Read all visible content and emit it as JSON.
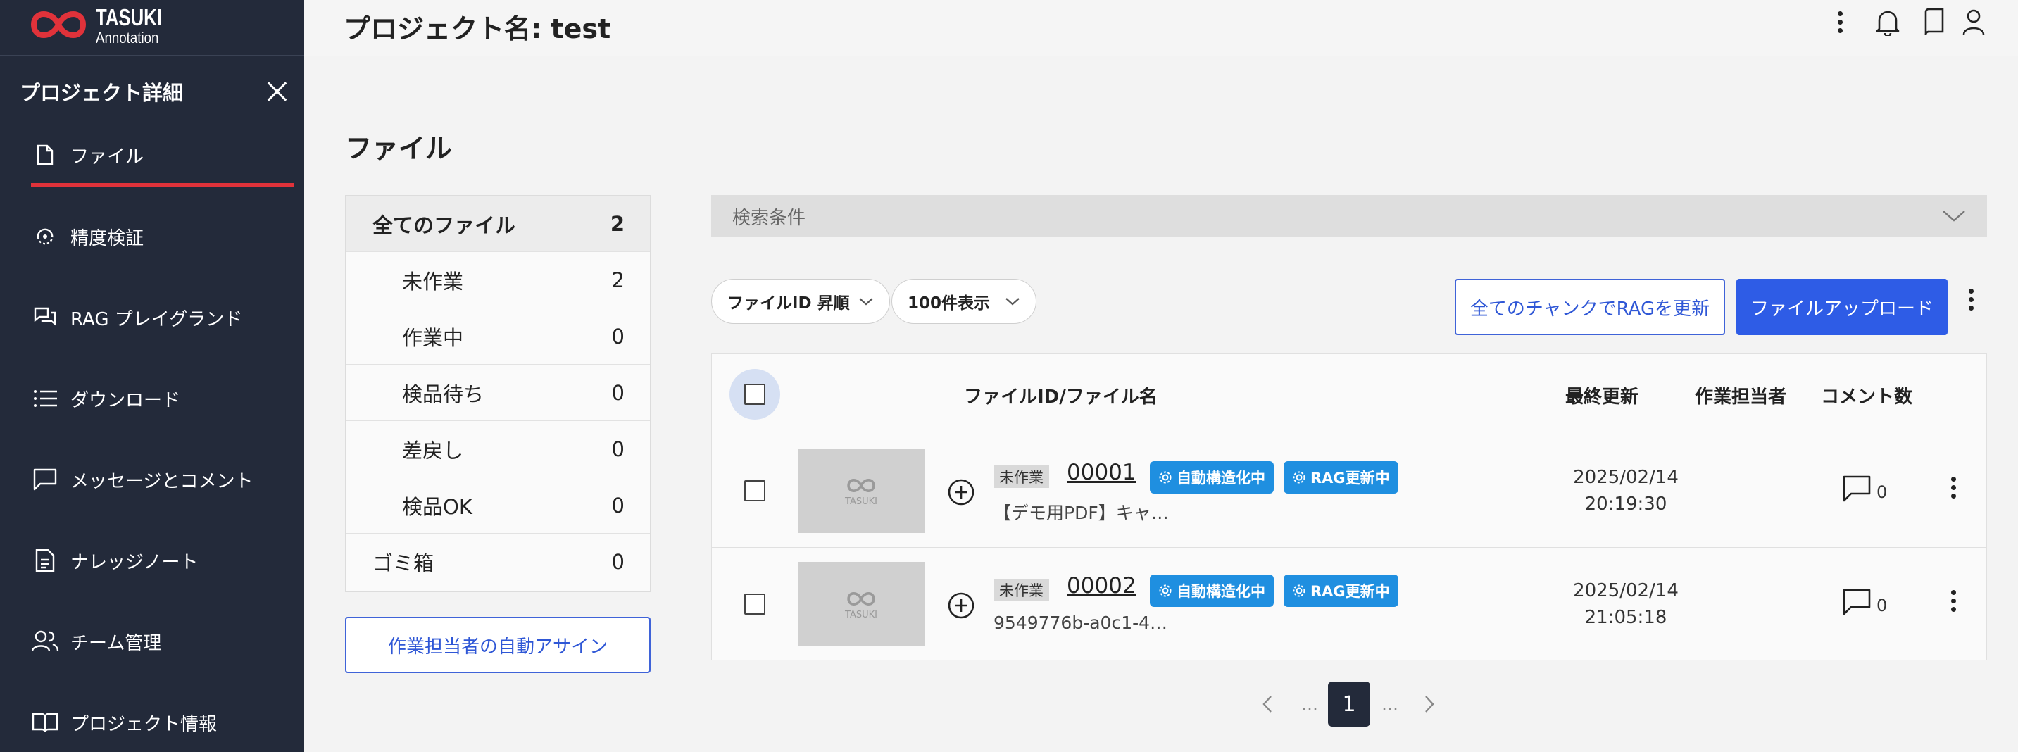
{
  "app": {
    "logo_title": "TASUKI",
    "logo_subtitle": "Annotation"
  },
  "header": {
    "title": "プロジェクト名: test"
  },
  "sidebar": {
    "title": "プロジェクト詳細",
    "items": [
      {
        "label": "ファイル",
        "icon": "file-icon"
      },
      {
        "label": "精度検証",
        "icon": "accuracy-icon"
      },
      {
        "label": "RAG プレイグランド",
        "icon": "chat-bubbles-icon"
      },
      {
        "label": "ダウンロード",
        "icon": "list-icon"
      },
      {
        "label": "メッセージとコメント",
        "icon": "message-icon"
      },
      {
        "label": "ナレッジノート",
        "icon": "document-icon"
      },
      {
        "label": "チーム管理",
        "icon": "team-icon"
      },
      {
        "label": "プロジェクト情報",
        "icon": "book-icon"
      }
    ]
  },
  "main": {
    "section_title": "ファイル",
    "status": [
      {
        "label": "全てのファイル",
        "count": "2"
      },
      {
        "label": "未作業",
        "count": "2"
      },
      {
        "label": "作業中",
        "count": "0"
      },
      {
        "label": "検品待ち",
        "count": "0"
      },
      {
        "label": "差戻し",
        "count": "0"
      },
      {
        "label": "検品OK",
        "count": "0"
      },
      {
        "label": "ゴミ箱",
        "count": "0"
      }
    ],
    "auto_assign_label": "作業担当者の自動アサイン",
    "search_label": "検索条件",
    "sort_label": "ファイルID 昇順",
    "per_page_label": "100件表示",
    "refresh_rag_label": "全てのチャンクでRAGを更新",
    "upload_label": "ファイルアップロード"
  },
  "table": {
    "headers": {
      "file": "ファイルID/ファイル名",
      "updated": "最終更新",
      "assignee": "作業担当者",
      "comments": "コメント数"
    },
    "rows": [
      {
        "status": "未作業",
        "id": "00001",
        "badge1": "自動構造化中",
        "badge2": "RAG更新中",
        "name": "【デモ用PDF】キャ…",
        "date": "2025/02/14",
        "time": "20:19:30",
        "comments": "0",
        "thumb": "TASUKI"
      },
      {
        "status": "未作業",
        "id": "00002",
        "badge1": "自動構造化中",
        "badge2": "RAG更新中",
        "name": "9549776b-a0c1-4…",
        "date": "2025/02/14",
        "time": "21:05:18",
        "comments": "0",
        "thumb": "TASUKI"
      }
    ]
  },
  "pagination": {
    "current": "1",
    "ellipsis": "…"
  },
  "colors": {
    "sidebar_bg": "#232a3a",
    "accent_red": "#e0323a",
    "primary_blue": "#2e5ce6",
    "badge_blue": "#1f8fe0"
  }
}
